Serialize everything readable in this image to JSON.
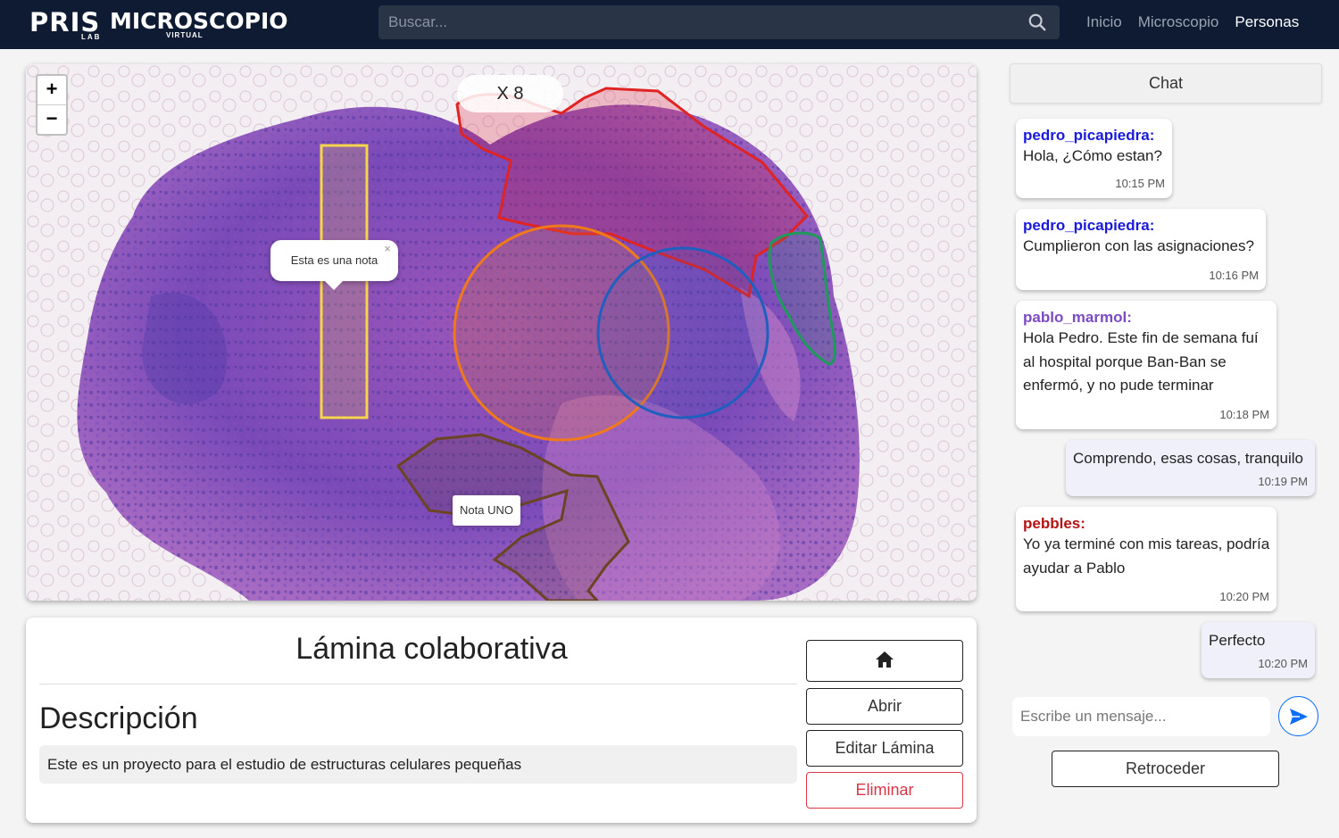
{
  "navbar": {
    "logo": {
      "brand": "PRIS",
      "lab": "LAB",
      "product": "MICROSCOPIO",
      "sub": "VIRTUAL"
    },
    "search": {
      "placeholder": "Buscar...",
      "icon": "search-icon"
    },
    "links": [
      {
        "label": "Inicio",
        "active": false
      },
      {
        "label": "Microscopio",
        "active": false
      },
      {
        "label": "Personas",
        "active": true
      }
    ]
  },
  "viewer": {
    "zoom_in_label": "+",
    "zoom_out_label": "−",
    "magnification": "X 8",
    "annotations": [
      {
        "type": "rectangle",
        "color": "#f6d54a"
      },
      {
        "type": "polygon",
        "color": "#e02424"
      },
      {
        "type": "circle",
        "color": "#f07a1a"
      },
      {
        "type": "circle",
        "color": "#1f5fbf"
      },
      {
        "type": "polygon",
        "color": "#1e9a5a"
      },
      {
        "type": "polygon",
        "color": "#6b4423"
      }
    ],
    "note_popup": {
      "text": "Esta es una nota",
      "close": "×"
    },
    "note_tag": {
      "text": "Nota UNO"
    }
  },
  "info": {
    "title": "Lámina colaborativa",
    "description_heading": "Descripción",
    "description": "Este es un proyecto para el estudio de estructuras celulares pequeñas",
    "buttons": {
      "home_icon": "home-icon",
      "open": "Abrir",
      "edit": "Editar Lámina",
      "delete": "Eliminar"
    }
  },
  "chat": {
    "header": "Chat",
    "messages": [
      {
        "user": "pedro_picapiedra:",
        "user_color": "#1a1adb",
        "text": "Hola, ¿Cómo estan?",
        "time": "10:15 PM",
        "mine": false
      },
      {
        "user": "pedro_picapiedra:",
        "user_color": "#1a1adb",
        "text": "Cumplieron con las asignaciones?",
        "time": "10:16 PM",
        "mine": false
      },
      {
        "user": "pablo_marmol:",
        "user_color": "#7b4bc4",
        "text": "Hola Pedro. Este fin de semana fuí al hospital porque Ban-Ban se enfermó, y no pude terminar",
        "time": "10:18 PM",
        "mine": false
      },
      {
        "user": "",
        "user_color": "",
        "text": "Comprendo, esas cosas, tranquilo",
        "time": "10:19 PM",
        "mine": true
      },
      {
        "user": "pebbles:",
        "user_color": "#b31414",
        "text": "Yo ya terminé con mis tareas, podría ayudar a Pablo",
        "time": "10:20 PM",
        "mine": false
      },
      {
        "user": "",
        "user_color": "",
        "text": "Perfecto",
        "time": "10:20 PM",
        "mine": true
      }
    ],
    "input_placeholder": "Escribe un mensaje...",
    "send_icon": "send-icon",
    "back_label": "Retroceder"
  }
}
